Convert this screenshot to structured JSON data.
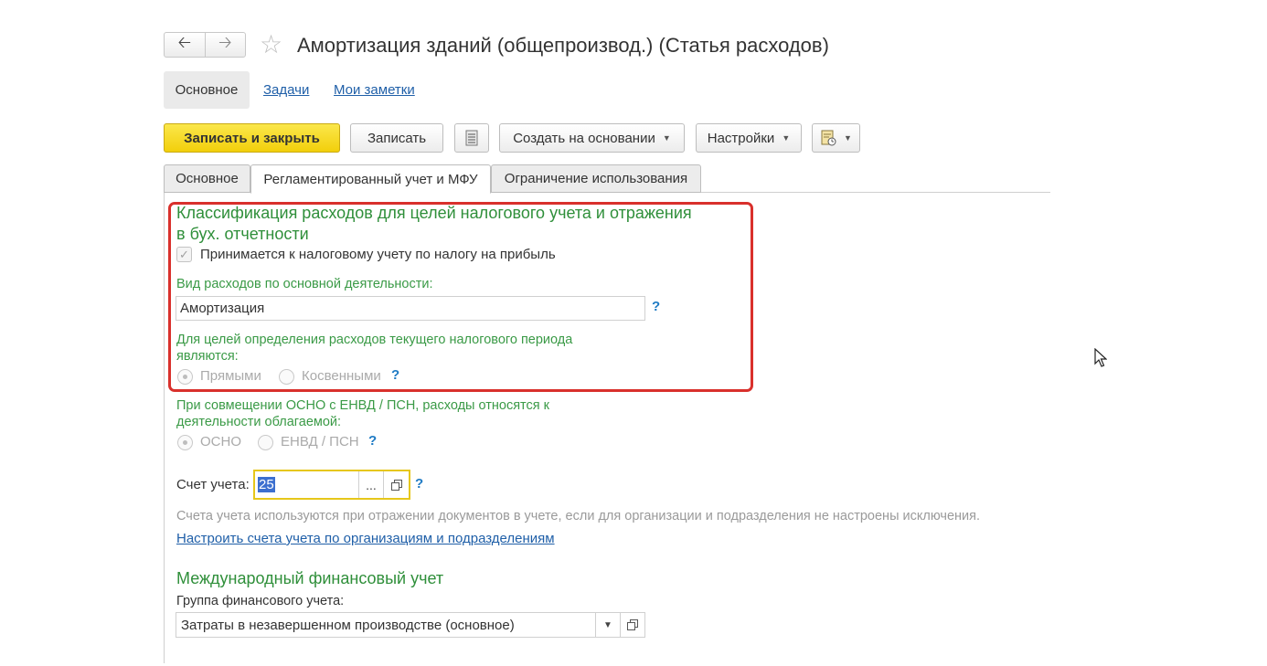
{
  "header": {
    "back_icon": "arrow-left-icon",
    "forward_icon": "arrow-right-icon",
    "favorite_icon": "star-icon",
    "title": "Амортизация зданий (общепроизвод.) (Статья расходов)"
  },
  "topnav": {
    "items": [
      {
        "label": "Основное",
        "active": true
      },
      {
        "label": "Задачи"
      },
      {
        "label": "Мои заметки"
      }
    ]
  },
  "toolbar": {
    "save_close": "Записать и закрыть",
    "save": "Записать",
    "list_icon": "document-list-icon",
    "create_based": "Создать на основании",
    "settings": "Настройки",
    "report_icon": "report-icon"
  },
  "tabs": [
    {
      "label": "Основное"
    },
    {
      "label": "Регламентированный учет и МФУ",
      "active": true
    },
    {
      "label": "Ограничение использования"
    }
  ],
  "tax_section": {
    "heading_line1": "Классификация расходов для целей налогового учета и отражения",
    "heading_line2": "в бух. отчетности",
    "profit_tax_checkbox": {
      "label": "Принимается к налоговому учету по налогу на прибыль",
      "checked": true
    },
    "expense_type_label": "Вид расходов по основной деятельности:",
    "expense_type_value": "Амортизация",
    "period_label_line1": "Для целей определения расходов текущего налогового периода",
    "period_label_line2": "являются:",
    "period_options": [
      {
        "label": "Прямыми",
        "selected": true
      },
      {
        "label": "Косвенными",
        "selected": false
      }
    ]
  },
  "envd_section": {
    "label_line1": "При совмещении ОСНО с ЕНВД / ПСН, расходы относятся к",
    "label_line2": "деятельности облагаемой:",
    "options": [
      {
        "label": "ОСНО",
        "selected": true
      },
      {
        "label": "ЕНВД / ПСН",
        "selected": false
      }
    ]
  },
  "account": {
    "label": "Счет учета:",
    "value": "25",
    "select_glyph": "...",
    "hint": "Счета учета используются при отражении документов в учете, если для организации и подразделения не настроены исключения.",
    "configure_link": "Настроить счета учета по организациям и подразделениям"
  },
  "ifrs_section": {
    "heading": "Международный финансовый учет",
    "group_label": "Группа финансового учета:",
    "group_value": "Затраты в незавершенном производстве (основное)"
  },
  "help_glyph": "?",
  "colors": {
    "primary_button": "#f2cf0b",
    "section_heading": "#2f8f3a",
    "highlight_frame": "#d9302c",
    "link": "#1f5fa8"
  }
}
